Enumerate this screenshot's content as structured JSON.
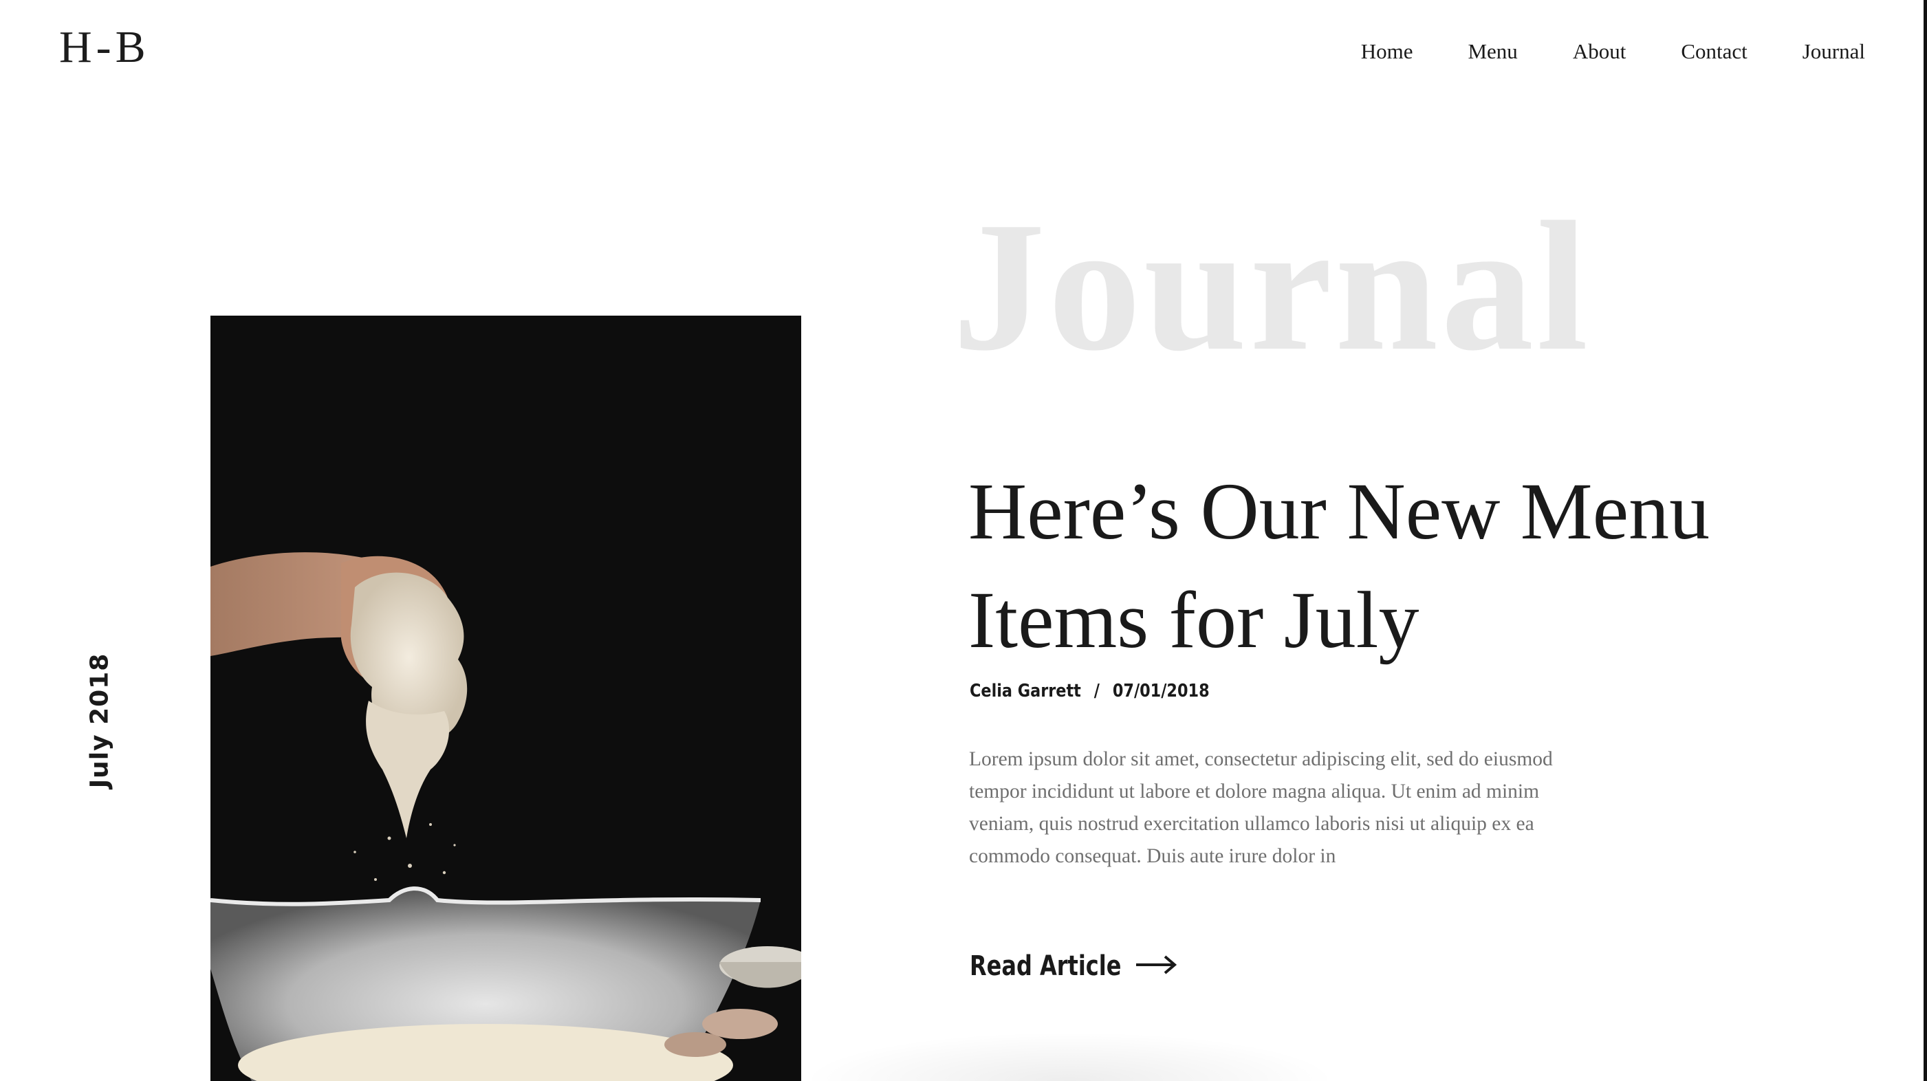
{
  "header": {
    "logo": "H-B",
    "nav": [
      "Home",
      "Menu",
      "About",
      "Contact",
      "Journal"
    ]
  },
  "sidebar": {
    "date_label": "July 2018"
  },
  "hero": {
    "watermark": "Journal",
    "title": "Here’s Our New Menu Items for July",
    "author": "Celia Garrett",
    "separator": "/",
    "date": "07/01/2018",
    "excerpt": "Lorem ipsum dolor sit amet, consectetur adipiscing elit, sed do eiusmod tempor incididunt ut labore et dolore magna aliqua. Ut enim ad minim veniam, quis nostrud exercitation ullamco laboris nisi ut aliquip ex ea commodo consequat. Duis aute irure dolor in",
    "cta_label": "Read Article",
    "image_icon": "baking-dough-photo",
    "arrow_icon": "arrow-right-icon"
  }
}
